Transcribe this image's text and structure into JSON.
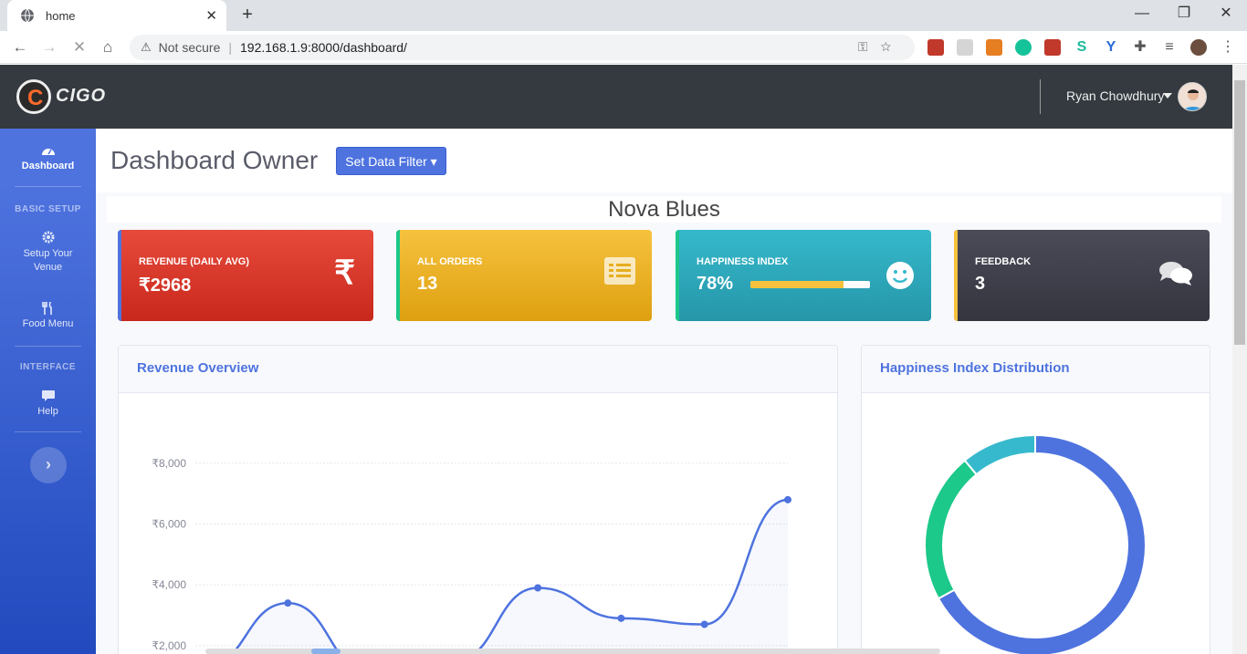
{
  "browser": {
    "tab_title": "home",
    "security_label": "Not secure",
    "url": "192.168.1.9:8000/dashboard/"
  },
  "app": {
    "brand": "CIGO",
    "user_name": "Ryan Chowdhury"
  },
  "sidebar": {
    "dashboard": "Dashboard",
    "basic_setup_heading": "BASIC SETUP",
    "setup_venue": "Setup Your Venue",
    "food_menu": "Food Menu",
    "interface_heading": "INTERFACE",
    "help": "Help"
  },
  "page": {
    "title": "Dashboard Owner",
    "filter_button": "Set Data Filter",
    "venue_name": "Nova Blues"
  },
  "cards": {
    "revenue": {
      "label": "REVENUE (DAILY AVG)",
      "value": "₹2968",
      "color": "#e74a3b",
      "icon": "rupee-icon"
    },
    "orders": {
      "label": "ALL ORDERS",
      "value": "13",
      "color": "#f6c23e",
      "icon": "list-icon"
    },
    "happiness": {
      "label": "HAPPINESS INDEX",
      "value": "78%",
      "progress": 0.78,
      "color": "#36b9cc",
      "icon": "smile-icon"
    },
    "feedback": {
      "label": "FEEDBACK",
      "value": "3",
      "color": "#3a3b45",
      "icon": "comments-icon"
    }
  },
  "revenue_panel": {
    "title": "Revenue Overview"
  },
  "happiness_panel": {
    "title": "Happiness Index Distribution"
  },
  "chart_data": [
    {
      "type": "line",
      "title": "Revenue Overview",
      "y_tick_labels": [
        "₹2,000",
        "₹4,000",
        "₹6,000",
        "₹8,000"
      ],
      "y_ticks": [
        2000,
        4000,
        6000,
        8000
      ],
      "ylim": [
        0,
        8600
      ],
      "x": [
        0,
        1,
        2,
        3,
        4,
        5,
        6,
        7
      ],
      "values": [
        1300,
        3400,
        1100,
        1500,
        3900,
        2900,
        2700,
        6800
      ],
      "color": "#4e73df",
      "grid": true
    },
    {
      "type": "pie",
      "title": "Happiness Index Distribution",
      "donut": true,
      "values": [
        67,
        22,
        11
      ],
      "colors": [
        "#4e73df",
        "#1cc88a",
        "#36b9cc"
      ]
    }
  ]
}
